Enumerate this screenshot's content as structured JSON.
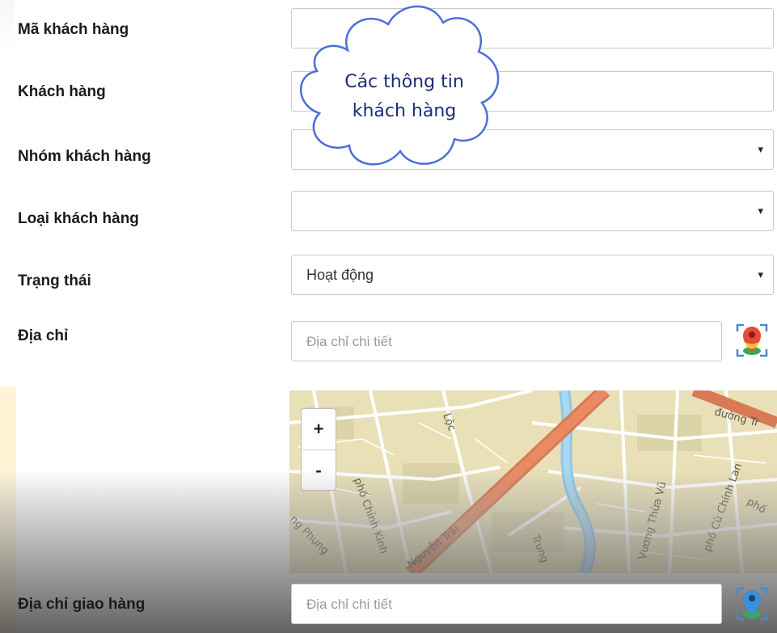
{
  "form": {
    "customer_code": {
      "label": "Mã khách hàng",
      "value": ""
    },
    "customer": {
      "label": "Khách hàng",
      "value": ""
    },
    "customer_group": {
      "label": "Nhóm khách hàng",
      "value": ""
    },
    "customer_type": {
      "label": "Loại khách hàng",
      "value": ""
    },
    "status": {
      "label": "Trạng thái",
      "value": "Hoạt động"
    },
    "address": {
      "label": "Địa chỉ",
      "placeholder": "Địa chỉ chi tiết"
    },
    "delivery_address": {
      "label": "Địa chỉ giao hàng",
      "placeholder": "Địa chỉ chi tiết"
    }
  },
  "map": {
    "zoom_in": "+",
    "zoom_out": "-",
    "street_labels": [
      "Lộc",
      "phố Chính Kinh",
      "Nguyễn Trãi",
      "Trung",
      "Vương Thừa Vũ",
      "phố Cù Chính Lan",
      "đường Tr",
      "phố",
      "ng Phụng"
    ]
  },
  "callout": {
    "line1": "Các thông tin",
    "line2": "khách hàng"
  },
  "icons": {
    "dropdown": "▾",
    "location": "map-pin-icon"
  },
  "colors": {
    "field_border": "#c9c9c9",
    "callout_stroke": "#4a6fd8",
    "callout_text": "#1c2b7a",
    "map_road": "#e07d5a"
  }
}
